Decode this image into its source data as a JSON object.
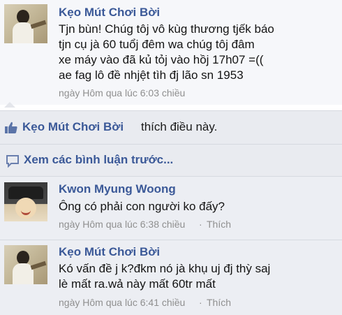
{
  "post": {
    "author": "Kẹo Mút Chơi Bời",
    "lines": [
      "Tjn bùn! Chúg tôj vô kùg thương tjếk báo",
      "tjn cụ jà 60 tuổj đêm wa chúg tôj đâm",
      "xe máy vào đã kủ tỏj vào hồj 17h07 =((",
      "ae fag lô đề nhjệt tìh đj lão sn 1953"
    ],
    "meta": "ngày Hôm qua lúc 6:03 chiều"
  },
  "like_row": {
    "name": "Kẹo Mút Chơi Bời",
    "text": "thích điều này."
  },
  "previous": {
    "label": "Xem các bình luận trước..."
  },
  "comments": [
    {
      "author": "Kwon Myung Woong",
      "text": "Ông có phải con người ko đấy?",
      "time": "ngày Hôm qua lúc 6:38 chiều",
      "action": "Thích"
    },
    {
      "author": "Kẹo Mút Chơi Bời",
      "lines": [
        "Kó vấn đề j k?đkm nó jà khụ uj đj thỳ saj",
        "lè mất ra.wả này mất 60tr mất"
      ],
      "time": "ngày Hôm qua lúc 6:41 chiều",
      "action": "Thích"
    }
  ],
  "colors": {
    "link": "#3b5998",
    "meta": "#8f8f8f"
  }
}
